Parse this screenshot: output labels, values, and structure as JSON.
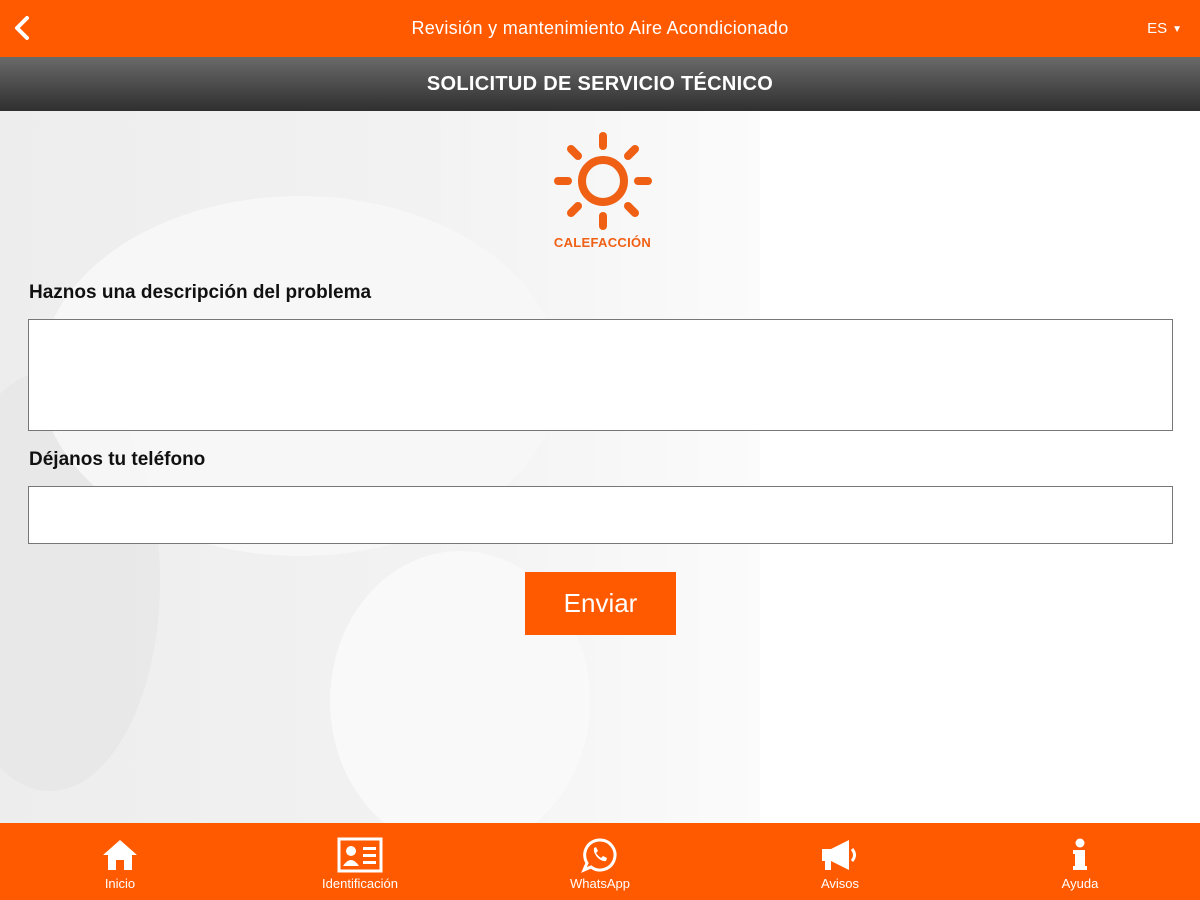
{
  "header": {
    "title": "Revisión y mantenimiento Aire Acondicionado",
    "back_icon": "chevron-left-icon",
    "language": "ES"
  },
  "subheader": {
    "title": "SOLICITUD DE SERVICIO TÉCNICO"
  },
  "category": {
    "icon": "sun-icon",
    "label": "CALEFACCIÓN",
    "color": "#f06014"
  },
  "form": {
    "description_label": "Haznos una descripción del problema",
    "description_value": "",
    "phone_label": "Déjanos tu teléfono",
    "phone_value": "",
    "submit_label": "Enviar"
  },
  "bottom_nav": {
    "items": [
      {
        "label": "Inicio",
        "icon": "home-icon"
      },
      {
        "label": "Identificación",
        "icon": "id-card-icon"
      },
      {
        "label": "WhatsApp",
        "icon": "whatsapp-icon"
      },
      {
        "label": "Avisos",
        "icon": "megaphone-icon"
      },
      {
        "label": "Ayuda",
        "icon": "info-icon"
      }
    ]
  },
  "colors": {
    "brand": "#ff5a00",
    "subheader_dark": "#3a3a3a"
  }
}
